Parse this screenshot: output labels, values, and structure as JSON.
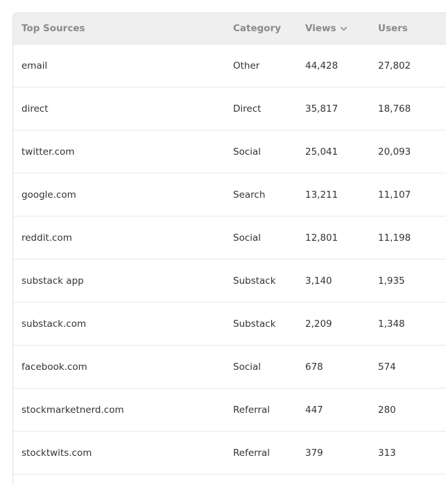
{
  "table": {
    "headers": {
      "source": "Top Sources",
      "category": "Category",
      "views": "Views",
      "users": "Users"
    },
    "sort_icon": "chevron-down-icon",
    "rows": [
      {
        "source": "email",
        "category": "Other",
        "views": "44,428",
        "users": "27,802"
      },
      {
        "source": "direct",
        "category": "Direct",
        "views": "35,817",
        "users": "18,768"
      },
      {
        "source": "twitter.com",
        "category": "Social",
        "views": "25,041",
        "users": "20,093"
      },
      {
        "source": "google.com",
        "category": "Search",
        "views": "13,211",
        "users": "11,107"
      },
      {
        "source": "reddit.com",
        "category": "Social",
        "views": "12,801",
        "users": "11,198"
      },
      {
        "source": "substack app",
        "category": "Substack",
        "views": "3,140",
        "users": "1,935"
      },
      {
        "source": "substack.com",
        "category": "Substack",
        "views": "2,209",
        "users": "1,348"
      },
      {
        "source": "facebook.com",
        "category": "Social",
        "views": "678",
        "users": "574"
      },
      {
        "source": "stockmarketnerd.com",
        "category": "Referral",
        "views": "447",
        "users": "280"
      },
      {
        "source": "stocktwits.com",
        "category": "Referral",
        "views": "379",
        "users": "313"
      }
    ]
  }
}
